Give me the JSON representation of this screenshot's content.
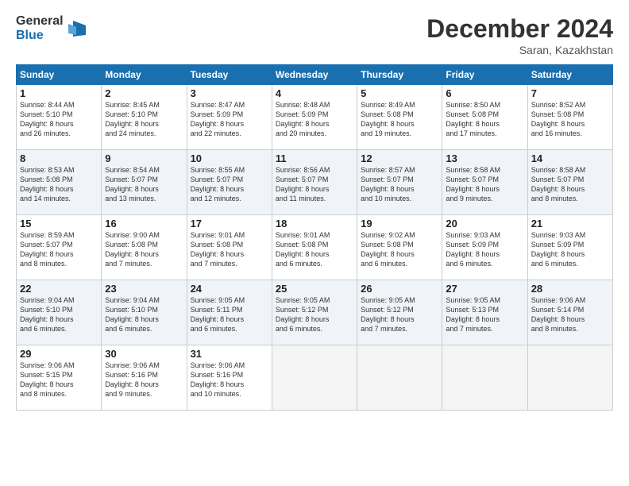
{
  "logo": {
    "general": "General",
    "blue": "Blue"
  },
  "title": "December 2024",
  "subtitle": "Saran, Kazakhstan",
  "columns": [
    "Sunday",
    "Monday",
    "Tuesday",
    "Wednesday",
    "Thursday",
    "Friday",
    "Saturday"
  ],
  "weeks": [
    [
      {
        "day": "1",
        "info": "Sunrise: 8:44 AM\nSunset: 5:10 PM\nDaylight: 8 hours\nand 26 minutes."
      },
      {
        "day": "2",
        "info": "Sunrise: 8:45 AM\nSunset: 5:10 PM\nDaylight: 8 hours\nand 24 minutes."
      },
      {
        "day": "3",
        "info": "Sunrise: 8:47 AM\nSunset: 5:09 PM\nDaylight: 8 hours\nand 22 minutes."
      },
      {
        "day": "4",
        "info": "Sunrise: 8:48 AM\nSunset: 5:09 PM\nDaylight: 8 hours\nand 20 minutes."
      },
      {
        "day": "5",
        "info": "Sunrise: 8:49 AM\nSunset: 5:08 PM\nDaylight: 8 hours\nand 19 minutes."
      },
      {
        "day": "6",
        "info": "Sunrise: 8:50 AM\nSunset: 5:08 PM\nDaylight: 8 hours\nand 17 minutes."
      },
      {
        "day": "7",
        "info": "Sunrise: 8:52 AM\nSunset: 5:08 PM\nDaylight: 8 hours\nand 16 minutes."
      }
    ],
    [
      {
        "day": "8",
        "info": "Sunrise: 8:53 AM\nSunset: 5:08 PM\nDaylight: 8 hours\nand 14 minutes."
      },
      {
        "day": "9",
        "info": "Sunrise: 8:54 AM\nSunset: 5:07 PM\nDaylight: 8 hours\nand 13 minutes."
      },
      {
        "day": "10",
        "info": "Sunrise: 8:55 AM\nSunset: 5:07 PM\nDaylight: 8 hours\nand 12 minutes."
      },
      {
        "day": "11",
        "info": "Sunrise: 8:56 AM\nSunset: 5:07 PM\nDaylight: 8 hours\nand 11 minutes."
      },
      {
        "day": "12",
        "info": "Sunrise: 8:57 AM\nSunset: 5:07 PM\nDaylight: 8 hours\nand 10 minutes."
      },
      {
        "day": "13",
        "info": "Sunrise: 8:58 AM\nSunset: 5:07 PM\nDaylight: 8 hours\nand 9 minutes."
      },
      {
        "day": "14",
        "info": "Sunrise: 8:58 AM\nSunset: 5:07 PM\nDaylight: 8 hours\nand 8 minutes."
      }
    ],
    [
      {
        "day": "15",
        "info": "Sunrise: 8:59 AM\nSunset: 5:07 PM\nDaylight: 8 hours\nand 8 minutes."
      },
      {
        "day": "16",
        "info": "Sunrise: 9:00 AM\nSunset: 5:08 PM\nDaylight: 8 hours\nand 7 minutes."
      },
      {
        "day": "17",
        "info": "Sunrise: 9:01 AM\nSunset: 5:08 PM\nDaylight: 8 hours\nand 7 minutes."
      },
      {
        "day": "18",
        "info": "Sunrise: 9:01 AM\nSunset: 5:08 PM\nDaylight: 8 hours\nand 6 minutes."
      },
      {
        "day": "19",
        "info": "Sunrise: 9:02 AM\nSunset: 5:08 PM\nDaylight: 8 hours\nand 6 minutes."
      },
      {
        "day": "20",
        "info": "Sunrise: 9:03 AM\nSunset: 5:09 PM\nDaylight: 8 hours\nand 6 minutes."
      },
      {
        "day": "21",
        "info": "Sunrise: 9:03 AM\nSunset: 5:09 PM\nDaylight: 8 hours\nand 6 minutes."
      }
    ],
    [
      {
        "day": "22",
        "info": "Sunrise: 9:04 AM\nSunset: 5:10 PM\nDaylight: 8 hours\nand 6 minutes."
      },
      {
        "day": "23",
        "info": "Sunrise: 9:04 AM\nSunset: 5:10 PM\nDaylight: 8 hours\nand 6 minutes."
      },
      {
        "day": "24",
        "info": "Sunrise: 9:05 AM\nSunset: 5:11 PM\nDaylight: 8 hours\nand 6 minutes."
      },
      {
        "day": "25",
        "info": "Sunrise: 9:05 AM\nSunset: 5:12 PM\nDaylight: 8 hours\nand 6 minutes."
      },
      {
        "day": "26",
        "info": "Sunrise: 9:05 AM\nSunset: 5:12 PM\nDaylight: 8 hours\nand 7 minutes."
      },
      {
        "day": "27",
        "info": "Sunrise: 9:05 AM\nSunset: 5:13 PM\nDaylight: 8 hours\nand 7 minutes."
      },
      {
        "day": "28",
        "info": "Sunrise: 9:06 AM\nSunset: 5:14 PM\nDaylight: 8 hours\nand 8 minutes."
      }
    ],
    [
      {
        "day": "29",
        "info": "Sunrise: 9:06 AM\nSunset: 5:15 PM\nDaylight: 8 hours\nand 8 minutes."
      },
      {
        "day": "30",
        "info": "Sunrise: 9:06 AM\nSunset: 5:16 PM\nDaylight: 8 hours\nand 9 minutes."
      },
      {
        "day": "31",
        "info": "Sunrise: 9:06 AM\nSunset: 5:16 PM\nDaylight: 8 hours\nand 10 minutes."
      },
      null,
      null,
      null,
      null
    ]
  ]
}
